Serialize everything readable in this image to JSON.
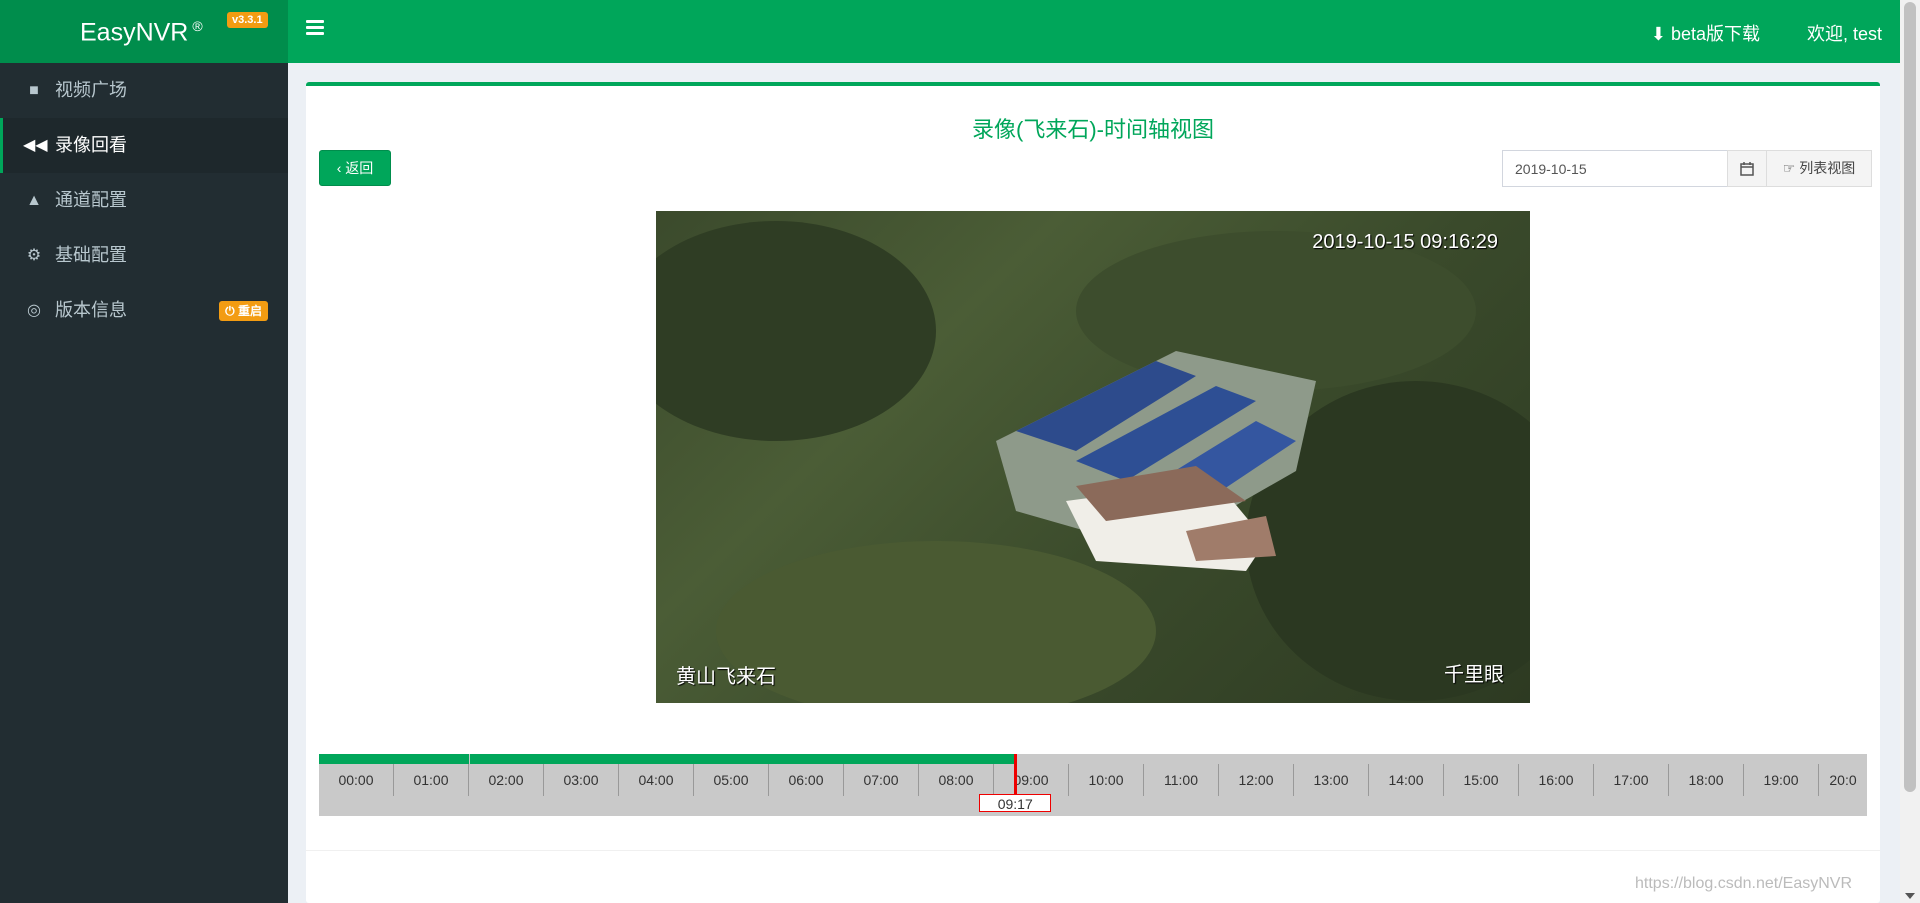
{
  "header": {
    "logo": "EasyNVR",
    "logo_mark": "®",
    "version": "v3.3.1",
    "beta_link": "beta版下载",
    "welcome": "欢迎, test",
    "brand_color": "#00a65a"
  },
  "sidebar": {
    "items": [
      {
        "label": "视频广场",
        "icon": "video-camera-icon"
      },
      {
        "label": "录像回看",
        "icon": "fast-backward-icon",
        "active": true
      },
      {
        "label": "通道配置",
        "icon": "road-icon"
      },
      {
        "label": "基础配置",
        "icon": "gears-icon"
      },
      {
        "label": "版本信息",
        "icon": "life-ring-icon",
        "badge": "重启"
      }
    ]
  },
  "main": {
    "title": "录像(飞来石)-时间轴视图",
    "back_button": "返回",
    "date_value": "2019-10-15",
    "list_view_button": "列表视图"
  },
  "video": {
    "timestamp": "2019-10-15 09:16:29",
    "location_label": "黄山飞来石",
    "brand_label": "千里眼"
  },
  "timeline": {
    "hours": [
      "00:00",
      "01:00",
      "02:00",
      "03:00",
      "04:00",
      "05:00",
      "06:00",
      "07:00",
      "08:00",
      "09:00",
      "10:00",
      "11:00",
      "12:00",
      "13:00",
      "14:00",
      "15:00",
      "16:00",
      "17:00",
      "18:00",
      "19:00",
      "20:0"
    ],
    "recorded_segments": [
      [
        "00:00",
        "02:00"
      ],
      [
        "02:00",
        "09:17"
      ]
    ],
    "cursor_time": "09:17"
  },
  "watermark": "https://blog.csdn.net/EasyNVR"
}
